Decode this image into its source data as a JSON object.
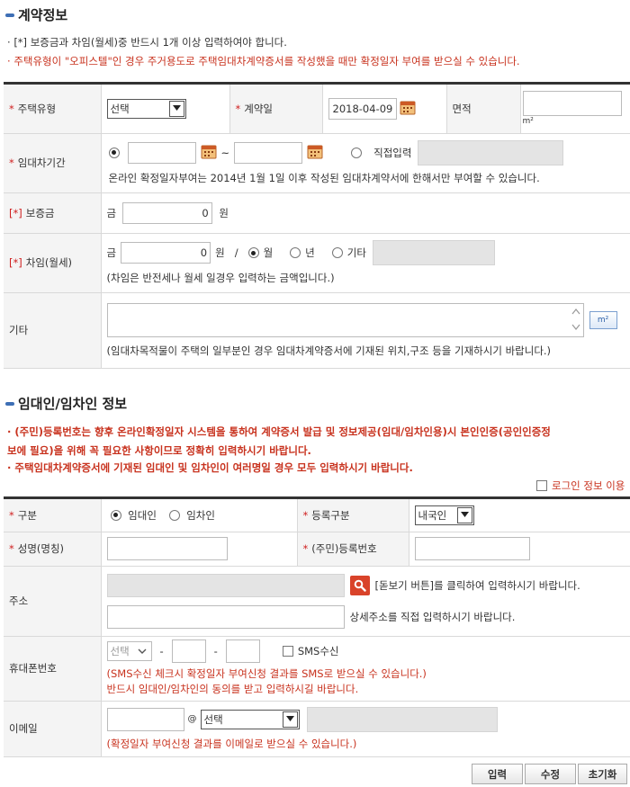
{
  "contract": {
    "title": "계약정보",
    "notes": [
      "[*] 보증금과 차임(월세)중 반드시 1개 이상 입력하여야 합니다.",
      "주택유형이 \"오피스텔\"인 경우 주거용도로 주택임대차계약증서를 작성했을 때만 확정일자 부여를 받으실 수 있습니다."
    ],
    "fields": {
      "housing_type_label": "주택유형",
      "housing_type_value": "선택",
      "contract_date_label": "계약일",
      "contract_date_value": "2018-04-09",
      "area_label": "면적",
      "area_unit": "m²",
      "period_label": "임대차기간",
      "period_sep": "~",
      "direct_input_label": "직접입력",
      "period_hint": "온라인 확정일자부여는 2014년 1월 1일 이후 작성된 임대차계약서에 한해서만 부여할 수 있습니다.",
      "deposit_mark": "[*]",
      "deposit_label": "보증금",
      "money_prefix": "금",
      "deposit_value": "0",
      "won": "원",
      "rent_mark": "[*]",
      "rent_label": "차임(월세)",
      "rent_value": "0",
      "slash": "/",
      "monthly_label": "월",
      "yearly_label": "년",
      "other_label": "기타",
      "rent_hint": "(차임은 반전세나 월세 일경우 입력하는 금액입니다.)",
      "etc_label": "기타",
      "m2_button": "m²",
      "etc_hint": "(임대차목적물이 주택의 일부분인 경우 임대차계약증서에 기재된 위치,구조 등을 기재하시기 바랍니다.)"
    }
  },
  "party": {
    "title": "임대인/임차인 정보",
    "notes": [
      "(주민)등록번호는 향후 온라인확정일자 시스템을 통하여 계약증서 발급 및 정보제공(임대/임차인용)시 본인인증(공인인증정",
      "보에 필요)을 위해 꼭 필요한 사항이므로 정확히 입력하시기 바랍니다.",
      "주택임대차계약증서에 기재된 임대인 및 임차인이 여러명일 경우 모두 입력하시기 바랍니다."
    ],
    "login_info_label": "로그인 정보 이용",
    "fields": {
      "type_label": "구분",
      "lessor_label": "임대인",
      "lessee_label": "임차인",
      "reg_type_label": "등록구분",
      "reg_type_value": "내국인",
      "name_label": "성명(명칭)",
      "id_label": "(주민)등록번호",
      "address_label": "주소",
      "lookup_hint": "[돋보기 버튼]를 클릭하여 입력하시기 바랍니다.",
      "detail_hint": "상세주소를 직접 입력하시기 바랍니다.",
      "phone_label": "휴대폰번호",
      "phone_select": "선택",
      "dash": "-",
      "sms_label": "SMS수신",
      "sms_hint1": "(SMS수신 체크시 확정일자 부여신청 결과를 SMS로 받으실 수 있습니다.)",
      "sms_hint2": "반드시 임대인/임차인의 동의를 받고 입력하시길 바랍니다.",
      "email_label": "이메일",
      "at": "@",
      "email_select": "선택",
      "email_hint": "(확정일자 부여신청 결과를 이메일로 받으실 수 있습니다.)"
    }
  },
  "buttons": {
    "input": "입력",
    "edit": "수정",
    "reset": "초기화"
  },
  "colors": {
    "accent": "#3e6fb5",
    "required": "#d01f1f",
    "notice": "#c8321e",
    "search_button": "#d9432a"
  }
}
